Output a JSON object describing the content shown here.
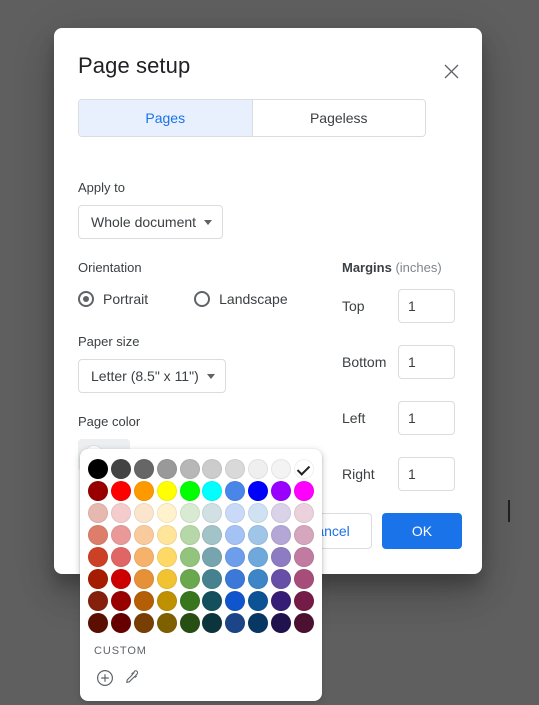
{
  "dialog": {
    "title": "Page setup",
    "close_icon": "close-icon"
  },
  "tabs": [
    {
      "label": "Pages",
      "active": true
    },
    {
      "label": "Pageless",
      "active": false
    }
  ],
  "apply_to": {
    "label": "Apply to",
    "value": "Whole document"
  },
  "orientation": {
    "label": "Orientation",
    "options": [
      {
        "label": "Portrait",
        "selected": true
      },
      {
        "label": "Landscape",
        "selected": false
      }
    ]
  },
  "paper_size": {
    "label": "Paper size",
    "value": "Letter (8.5\" x 11\")"
  },
  "page_color": {
    "label": "Page color",
    "current": "#ffffff",
    "caret_icon": "chevron-up-icon"
  },
  "margins": {
    "heading": "Margins",
    "unit": " (inches)",
    "rows": [
      {
        "label": "Top",
        "value": "1"
      },
      {
        "label": "Bottom",
        "value": "1"
      },
      {
        "label": "Left",
        "value": "1"
      },
      {
        "label": "Right",
        "value": "1"
      }
    ]
  },
  "footer": {
    "cancel_label": "Cancel",
    "ok_label": "OK"
  },
  "color_popup": {
    "custom_label": "CUSTOM",
    "add_icon": "plus-circle-icon",
    "eyedropper_icon": "eyedropper-icon",
    "selected_index": 9,
    "swatches": [
      "#000000",
      "#434343",
      "#666666",
      "#999999",
      "#b7b7b7",
      "#cccccc",
      "#d9d9d9",
      "#efefef",
      "#f3f3f3",
      "#ffffff",
      "#980000",
      "#ff0000",
      "#ff9900",
      "#ffff00",
      "#00ff00",
      "#00ffff",
      "#4a86e8",
      "#0000ff",
      "#9900ff",
      "#ff00ff",
      "#e6b8af",
      "#f4cccc",
      "#fce5cd",
      "#fff2cc",
      "#d9ead3",
      "#d0e0e3",
      "#c9daf8",
      "#cfe2f3",
      "#d9d2e9",
      "#ead1dc",
      "#dd7e6b",
      "#ea9999",
      "#f9cb9c",
      "#ffe599",
      "#b6d7a8",
      "#a2c4c9",
      "#a4c2f4",
      "#9fc5e8",
      "#b4a7d6",
      "#d5a6bd",
      "#cc4125",
      "#e06666",
      "#f6b26b",
      "#ffd966",
      "#93c47d",
      "#76a5af",
      "#6d9eeb",
      "#6fa8dc",
      "#8e7cc3",
      "#c27ba0",
      "#a61c00",
      "#cc0000",
      "#e69138",
      "#f1c232",
      "#6aa84f",
      "#45818e",
      "#3c78d8",
      "#3d85c6",
      "#674ea7",
      "#a64d79",
      "#85200c",
      "#990000",
      "#b45f06",
      "#bf9000",
      "#38761d",
      "#134f5c",
      "#1155cc",
      "#0b5394",
      "#351c75",
      "#741b47",
      "#5b0f00",
      "#660000",
      "#783f04",
      "#7f6000",
      "#274e13",
      "#0c343d",
      "#1c4587",
      "#073763",
      "#20124d",
      "#4c1130"
    ]
  }
}
